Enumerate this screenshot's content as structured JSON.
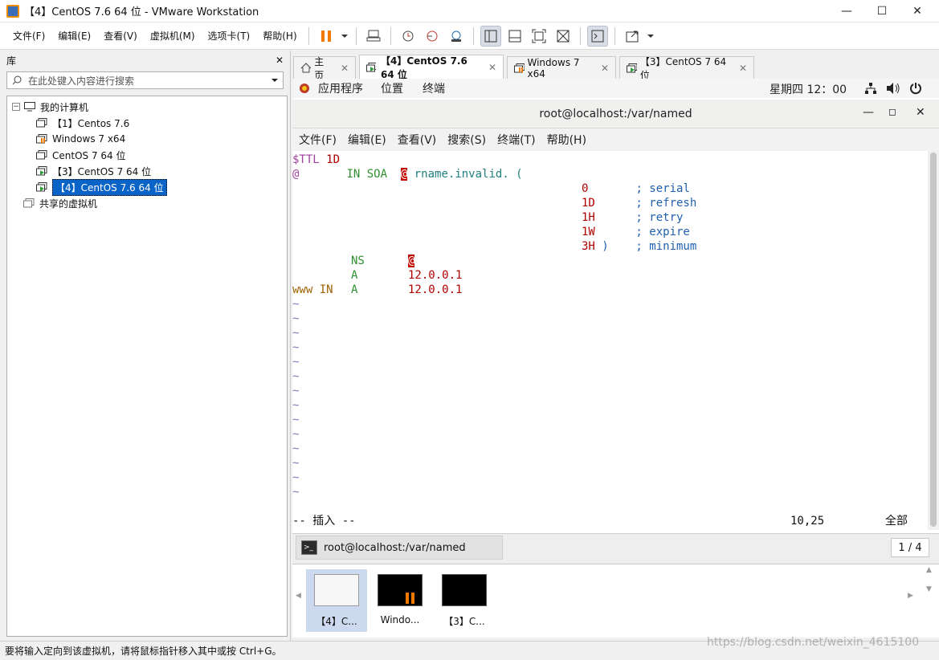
{
  "window": {
    "title": "【4】CentOS 7.6 64 位 - VMware Workstation",
    "min": "—",
    "max": "☐",
    "close": "✕"
  },
  "menu": [
    "文件(F)",
    "编辑(E)",
    "查看(V)",
    "虚拟机(M)",
    "选项卡(T)",
    "帮助(H)"
  ],
  "library": {
    "title": "库",
    "close": "✕",
    "search_placeholder": "在此处键入内容进行搜索",
    "tree": {
      "root": "我的计算机",
      "items": [
        "【1】Centos 7.6",
        "Windows 7 x64",
        "CentOS 7 64 位",
        "【3】CentOS 7 64 位",
        "【4】CentOS 7.6 64 位"
      ],
      "shared": "共享的虚拟机"
    }
  },
  "tabs": [
    {
      "label": "主页"
    },
    {
      "label": "【4】CentOS 7.6 64 位"
    },
    {
      "label": "Windows 7 x64"
    },
    {
      "label": "【3】CentOS 7 64 位"
    }
  ],
  "guest": {
    "topbar": {
      "apps": "应用程序",
      "places": "位置",
      "terminal": "终端",
      "clock": "星期四 12：00"
    },
    "terminal": {
      "title": "root@localhost:/var/named",
      "min": "—",
      "max": "◻",
      "close": "✕",
      "menu": [
        "文件(F)",
        "编辑(E)",
        "查看(V)",
        "搜索(S)",
        "终端(T)",
        "帮助(H)"
      ],
      "lines": {
        "l1a": "$TTL",
        "l1b": " 1D",
        "l2a": "@",
        "l2b": "       IN SOA  ",
        "l2c": "@",
        "l2d": " rname.invalid. (",
        "l3a": "0",
        "l3b": "       ; serial",
        "l4a": "1D",
        "l4b": "      ; refresh",
        "l5a": "1H",
        "l5b": "      ; retry",
        "l6a": "1W",
        "l6b": "      ; expire",
        "l7a": "3H",
        "l7b": " )    ; minimum",
        "l8a": "NS",
        "l8b": "@",
        "l9a": "A",
        "l9b": "12.0.0.1",
        "l10a": "www IN",
        "l10b": "A",
        "l10c": "12.0.0.1",
        "tilde": "~"
      },
      "status": {
        "mode": "-- 插入 --",
        "pos": "10,25",
        "scope": "全部"
      },
      "task": "root@localhost:/var/named",
      "pager": "1 / 4"
    }
  },
  "thumbnails": [
    {
      "caption": "【4】C..."
    },
    {
      "caption": "Windo..."
    },
    {
      "caption": "【3】C..."
    }
  ],
  "statusbar": "要将输入定向到该虚拟机，请将鼠标指针移入其中或按 Ctrl+G。",
  "watermark": "https://blog.csdn.net/weixin_4615100"
}
